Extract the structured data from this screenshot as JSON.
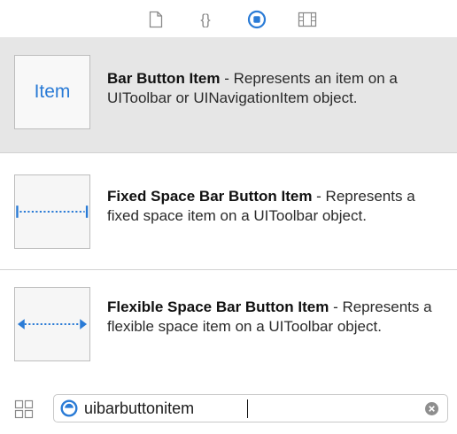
{
  "tabs": [
    {
      "icon": "file-template-icon",
      "selected": false
    },
    {
      "icon": "code-snippet-icon",
      "selected": false
    },
    {
      "icon": "object-library-icon",
      "selected": true
    },
    {
      "icon": "media-library-icon",
      "selected": false
    }
  ],
  "items": [
    {
      "name": "Bar Button Item",
      "separator": " - ",
      "description": "Represents an item on a UIToolbar or UINavigationItem object.",
      "thumb_text": "Item",
      "selected": true
    },
    {
      "name": "Fixed Space Bar Button Item",
      "separator": " - ",
      "description": "Represents a fixed space item on a UIToolbar object.",
      "thumb_icon": "fixed-space-icon",
      "selected": false
    },
    {
      "name": "Flexible Space Bar Button Item",
      "separator": " - ",
      "description": "Represents a flexible space item on a UIToolbar object.",
      "thumb_icon": "flexible-space-icon",
      "selected": false
    }
  ],
  "filter": {
    "value": "uibarbuttonitem",
    "view_toggle_icon": "grid-view-icon",
    "scope_icon": "filter-scope-icon",
    "clear_icon": "clear-icon"
  },
  "colors": {
    "accent": "#2a7bd6",
    "selected_row": "#e6e6e6",
    "separator": "#d2d2d2"
  }
}
